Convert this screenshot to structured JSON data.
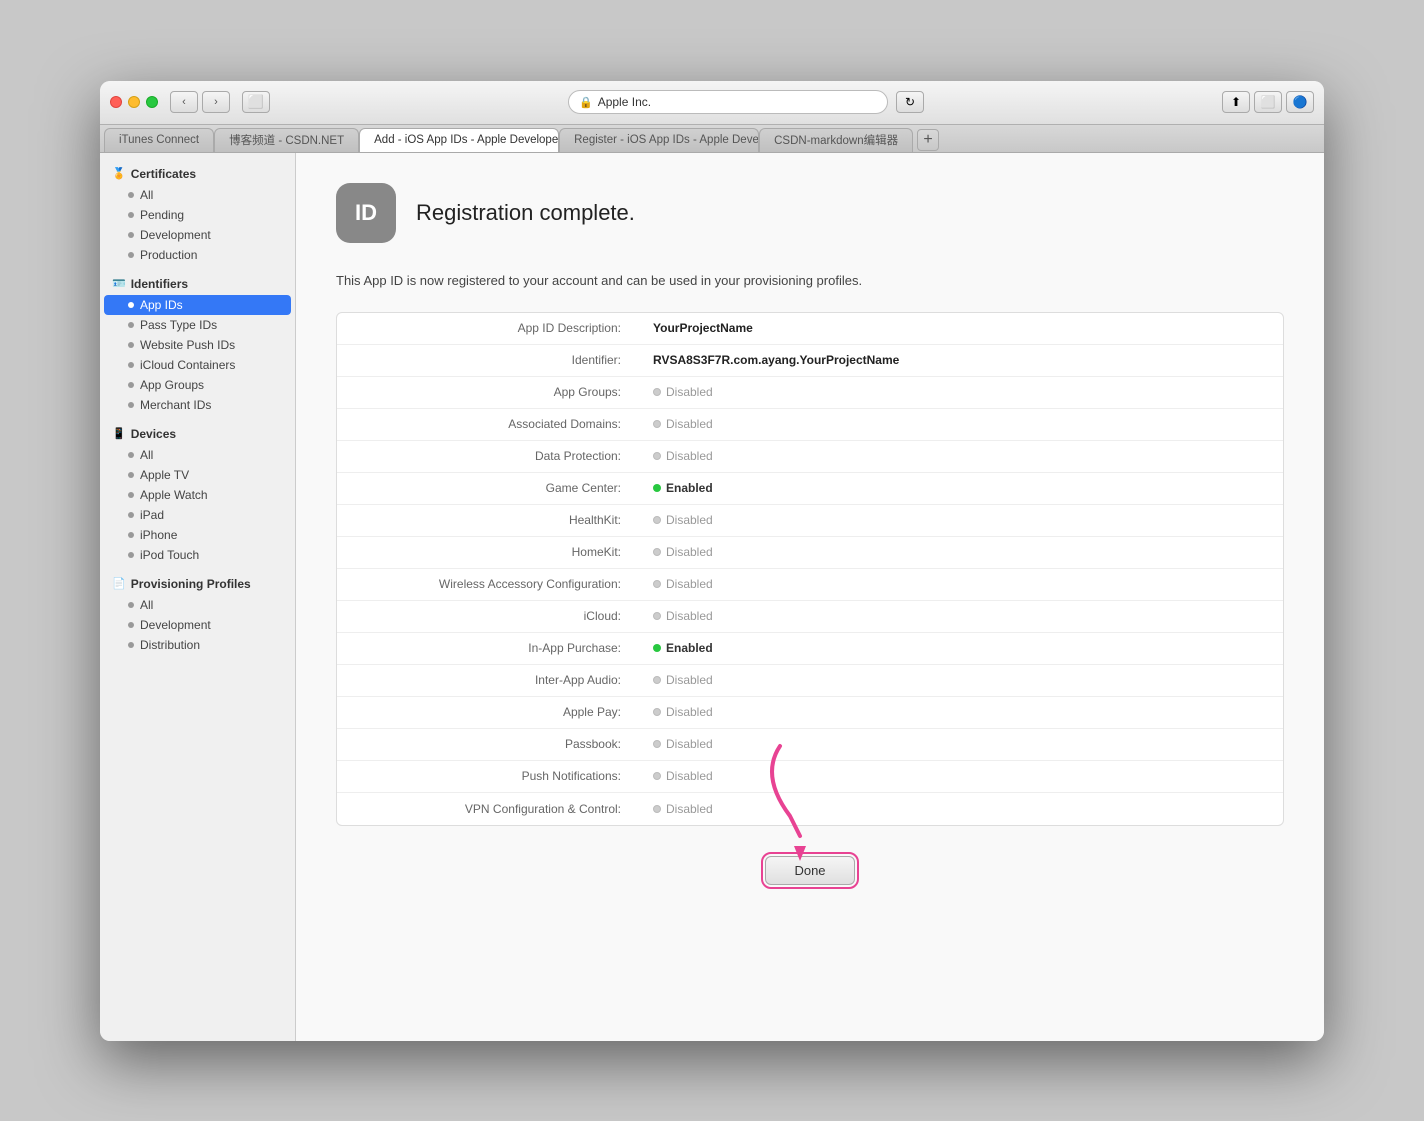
{
  "window": {
    "address_bar": {
      "lock_symbol": "🔒",
      "url": "Apple Inc.",
      "reload_symbol": "↻"
    },
    "tabs": [
      {
        "id": "tab-itunes",
        "label": "iTunes Connect",
        "active": false
      },
      {
        "id": "tab-csdn",
        "label": "博客频道 - CSDN.NET",
        "active": false
      },
      {
        "id": "tab-add",
        "label": "Add - iOS App IDs - Apple Developer",
        "active": true
      },
      {
        "id": "tab-register",
        "label": "Register - iOS App IDs - Apple Developer",
        "active": false
      },
      {
        "id": "tab-csdn-md",
        "label": "CSDN-markdown编辑器",
        "active": false
      }
    ]
  },
  "sidebar": {
    "sections": [
      {
        "id": "certificates",
        "icon": "🏅",
        "label": "Certificates",
        "items": [
          {
            "id": "all-certs",
            "label": "All"
          },
          {
            "id": "pending",
            "label": "Pending"
          },
          {
            "id": "development",
            "label": "Development"
          },
          {
            "id": "production",
            "label": "Production"
          }
        ]
      },
      {
        "id": "identifiers",
        "icon": "🪪",
        "label": "Identifiers",
        "items": [
          {
            "id": "app-ids",
            "label": "App IDs",
            "active": true
          },
          {
            "id": "pass-type-ids",
            "label": "Pass Type IDs"
          },
          {
            "id": "website-push-ids",
            "label": "Website Push IDs"
          },
          {
            "id": "icloud-containers",
            "label": "iCloud Containers"
          },
          {
            "id": "app-groups",
            "label": "App Groups"
          },
          {
            "id": "merchant-ids",
            "label": "Merchant IDs"
          }
        ]
      },
      {
        "id": "devices",
        "icon": "📱",
        "label": "Devices",
        "items": [
          {
            "id": "all-devices",
            "label": "All"
          },
          {
            "id": "apple-tv",
            "label": "Apple TV"
          },
          {
            "id": "apple-watch",
            "label": "Apple Watch"
          },
          {
            "id": "ipad",
            "label": "iPad"
          },
          {
            "id": "iphone",
            "label": "iPhone"
          },
          {
            "id": "ipod-touch",
            "label": "iPod Touch"
          }
        ]
      },
      {
        "id": "provisioning-profiles",
        "icon": "📄",
        "label": "Provisioning Profiles",
        "items": [
          {
            "id": "all-profiles",
            "label": "All"
          },
          {
            "id": "dev-profiles",
            "label": "Development"
          },
          {
            "id": "dist-profiles",
            "label": "Distribution"
          }
        ]
      }
    ]
  },
  "panel": {
    "icon_text": "ID",
    "title": "Registration complete.",
    "description": "This App ID is now registered to your account and can be used in your provisioning profiles.",
    "fields": [
      {
        "id": "app-id-desc",
        "label": "App ID Description:",
        "value": "YourProjectName",
        "bold": true,
        "status": null
      },
      {
        "id": "identifier",
        "label": "Identifier:",
        "value": "RVSA8S3F7R.com.ayang.YourProjectName",
        "bold": true,
        "status": null
      },
      {
        "id": "app-groups",
        "label": "App Groups:",
        "value": "Disabled",
        "bold": false,
        "status": "disabled"
      },
      {
        "id": "associated-domains",
        "label": "Associated Domains:",
        "value": "Disabled",
        "bold": false,
        "status": "disabled"
      },
      {
        "id": "data-protection",
        "label": "Data Protection:",
        "value": "Disabled",
        "bold": false,
        "status": "disabled"
      },
      {
        "id": "game-center",
        "label": "Game Center:",
        "value": "Enabled",
        "bold": false,
        "status": "enabled"
      },
      {
        "id": "healthkit",
        "label": "HealthKit:",
        "value": "Disabled",
        "bold": false,
        "status": "disabled"
      },
      {
        "id": "homekit",
        "label": "HomeKit:",
        "value": "Disabled",
        "bold": false,
        "status": "disabled"
      },
      {
        "id": "wireless-accessory",
        "label": "Wireless Accessory Configuration:",
        "value": "Disabled",
        "bold": false,
        "status": "disabled"
      },
      {
        "id": "icloud",
        "label": "iCloud:",
        "value": "Disabled",
        "bold": false,
        "status": "disabled"
      },
      {
        "id": "in-app-purchase",
        "label": "In-App Purchase:",
        "value": "Enabled",
        "bold": false,
        "status": "enabled"
      },
      {
        "id": "inter-app-audio",
        "label": "Inter-App Audio:",
        "value": "Disabled",
        "bold": false,
        "status": "disabled"
      },
      {
        "id": "apple-pay",
        "label": "Apple Pay:",
        "value": "Disabled",
        "bold": false,
        "status": "disabled"
      },
      {
        "id": "passbook",
        "label": "Passbook:",
        "value": "Disabled",
        "bold": false,
        "status": "disabled"
      },
      {
        "id": "push-notifications",
        "label": "Push Notifications:",
        "value": "Disabled",
        "bold": false,
        "status": "disabled"
      },
      {
        "id": "vpn-config",
        "label": "VPN Configuration & Control:",
        "value": "Disabled",
        "bold": false,
        "status": "disabled"
      }
    ],
    "done_button": "Done"
  }
}
